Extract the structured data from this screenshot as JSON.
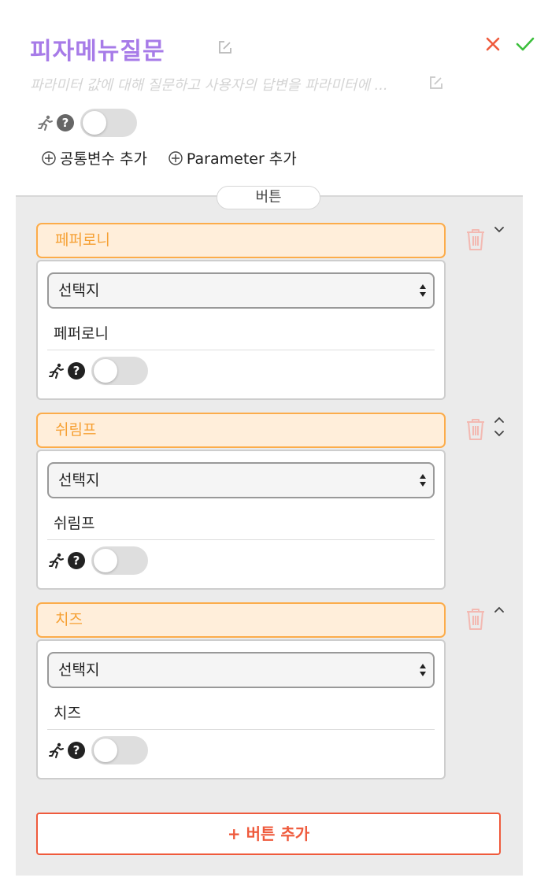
{
  "header": {
    "title": "피자메뉴질문",
    "description": "파라미터 값에 대해 질문하고 사용자의 답변을 파라미터에 ...",
    "add_common_variable_label": "공통변수 추가",
    "add_parameter_label": "Parameter 추가",
    "toggle_on": false
  },
  "panel": {
    "tab_label": "버튼",
    "items": [
      {
        "title": "페퍼로니",
        "select_value": "선택지",
        "answer": "페퍼로니",
        "toggle_on": false,
        "move_up": false,
        "move_down": true
      },
      {
        "title": "쉬림프",
        "select_value": "선택지",
        "answer": "쉬림프",
        "toggle_on": false,
        "move_up": true,
        "move_down": true
      },
      {
        "title": "치즈",
        "select_value": "선택지",
        "answer": "치즈",
        "toggle_on": false,
        "move_up": true,
        "move_down": false
      }
    ],
    "add_button_label": "+ 버튼 추가"
  },
  "icons": {
    "title_edit": "edit-icon",
    "close": "close-icon",
    "confirm": "check-icon",
    "run": "running-person-icon",
    "help": "question-circle-icon",
    "trash": "trash-icon",
    "move_up": "chevron-up-icon",
    "move_down": "chevron-down-icon",
    "add": "plus-circle-icon"
  },
  "colors": {
    "title": "#a77be8",
    "accent_orange": "#f6a033",
    "item_head_bg": "#ffeeda",
    "danger": "#ef5a3c",
    "confirm": "#3cbf3c",
    "trash": "#f3b9b2"
  }
}
